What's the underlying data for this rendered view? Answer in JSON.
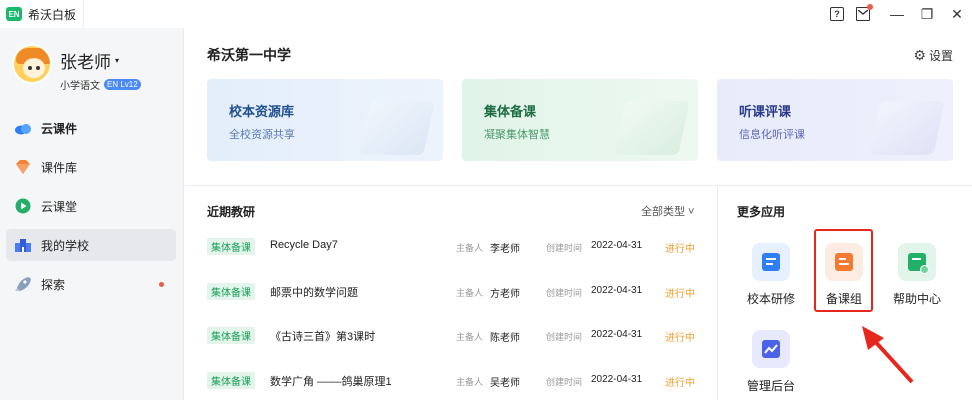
{
  "titlebar": {
    "logo_text": "EN",
    "app_title": "希沃白板",
    "help_icon_text": "?",
    "minimize_glyph": "—",
    "restore_glyph": "❐",
    "close_glyph": "✕"
  },
  "profile": {
    "name": "张老师",
    "caret": "▾",
    "subject": "小学语文",
    "level_badge": "EN Lv12"
  },
  "nav": {
    "items": [
      {
        "label": "云课件",
        "icon": "cloud-icon"
      },
      {
        "label": "课件库",
        "icon": "gem-icon"
      },
      {
        "label": "云课堂",
        "icon": "play-circle-icon"
      },
      {
        "label": "我的学校",
        "icon": "school-icon"
      },
      {
        "label": "探索",
        "icon": "rocket-icon"
      }
    ]
  },
  "header": {
    "school_name": "希沃第一中学",
    "settings_label": "设置",
    "settings_icon": "⚙"
  },
  "cards": [
    {
      "title": "校本资源库",
      "subtitle": "全校资源共享"
    },
    {
      "title": "集体备课",
      "subtitle": "凝聚集体智慧"
    },
    {
      "title": "听课评课",
      "subtitle": "信息化听评课"
    }
  ],
  "recent": {
    "title": "近期教研",
    "filter_label": "全部类型 ˅",
    "host_label": "主备人",
    "created_label": "创建时间",
    "rows": [
      {
        "tag": "集体备课",
        "title": "Recycle Day7",
        "host": "李老师",
        "date": "2022-04-31",
        "status": "进行中"
      },
      {
        "tag": "集体备课",
        "title": "邮票中的数学问题",
        "host": "方老师",
        "date": "2022-04-31",
        "status": "进行中"
      },
      {
        "tag": "集体备课",
        "title": "《古诗三首》第3课时",
        "host": "陈老师",
        "date": "2022-04-31",
        "status": "进行中"
      },
      {
        "tag": "集体备课",
        "title": "数学广角 ––––鸽巢原理1",
        "host": "吴老师",
        "date": "2022-04-31",
        "status": "进行中"
      }
    ]
  },
  "more_apps": {
    "title": "更多应用",
    "apps": [
      {
        "label": "校本研修",
        "icon": "document-icon",
        "color": "#2f7ef5",
        "bg": "#e6f0fe"
      },
      {
        "label": "备课组",
        "icon": "lesson-group-icon",
        "color": "#f57a2f",
        "bg": "#fdece1"
      },
      {
        "label": "帮助中心",
        "icon": "help-center-icon",
        "color": "#22b069",
        "bg": "#e1f5ea"
      },
      {
        "label": "管理后台",
        "icon": "admin-chart-icon",
        "color": "#4b63e8",
        "bg": "#e7eafc"
      }
    ]
  },
  "colors": {
    "accent_green": "#19b96b",
    "tag_green": "#1b9e57",
    "status_orange": "#f0a030",
    "highlight_red": "#e8271c"
  }
}
